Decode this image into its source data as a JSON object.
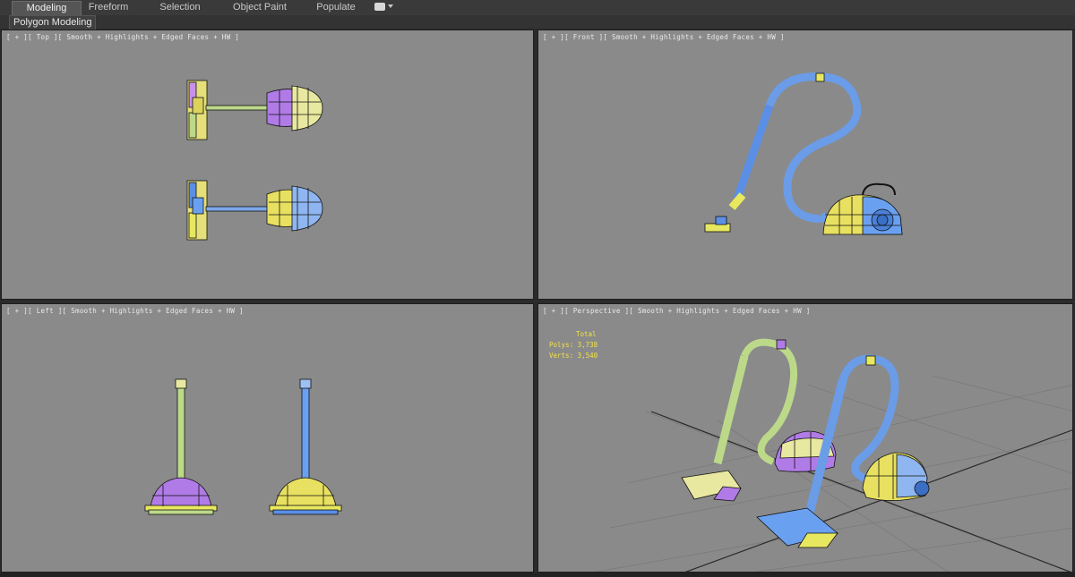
{
  "ribbon": {
    "tabs": [
      {
        "label": "Modeling",
        "active": true
      },
      {
        "label": "Freeform",
        "active": false
      },
      {
        "label": "Selection",
        "active": false
      },
      {
        "label": "Object Paint",
        "active": false
      },
      {
        "label": "Populate",
        "active": false
      }
    ],
    "panel_label": "Polygon Modeling"
  },
  "viewports": {
    "top": {
      "label": "[ + ][ Top ][ Smooth + Highlights + Edged Faces + HW ]"
    },
    "front": {
      "label": "[ + ][ Front ][ Smooth + Highlights + Edged Faces + HW ]"
    },
    "left": {
      "label": "[ + ][ Left ][ Smooth + Highlights + Edged Faces + HW ]"
    },
    "perspective": {
      "label": "[ + ][ Perspective ][ Smooth + Highlights + Edged Faces + HW ]"
    }
  },
  "stats": {
    "header": "Total",
    "polys_label": "Polys:",
    "polys_value": "3,738",
    "verts_label": "Verts:",
    "verts_value": "3,540"
  },
  "colors": {
    "viewport_bg": "#8a8a8a",
    "blue": "#5b8fe6",
    "yellow": "#e8e860",
    "purple": "#b07be6",
    "green": "#bcd98a",
    "stats_text": "#f2e34a"
  },
  "icons": {
    "workspace_menu": "camera-dropdown-icon"
  }
}
